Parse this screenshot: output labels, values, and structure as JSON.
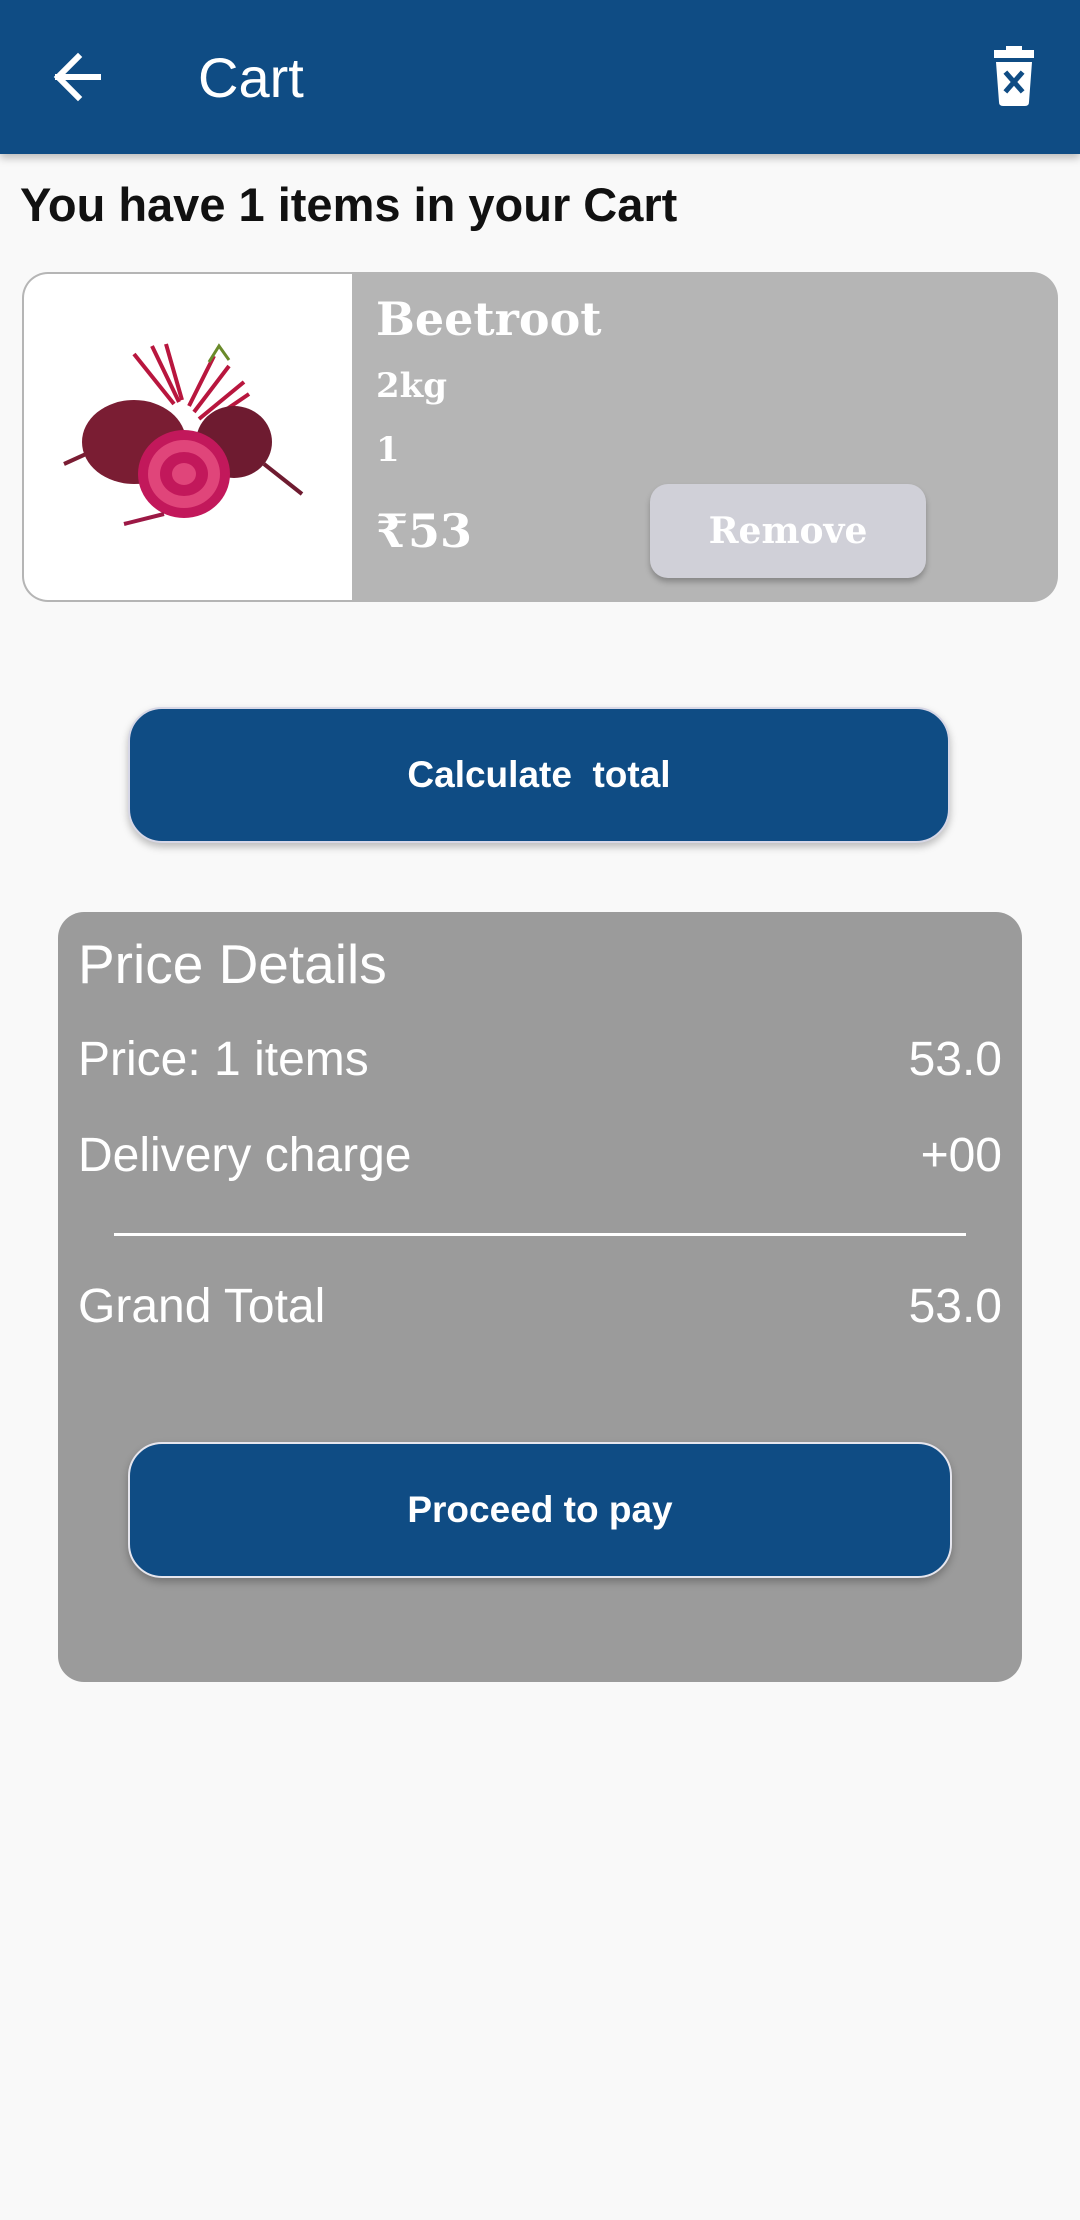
{
  "appbar": {
    "title": "Cart",
    "back_icon": "arrow-left-icon",
    "delete_icon": "trash-icon",
    "bg_color": "#0f4c84"
  },
  "cart": {
    "count_text": "You have 1 items in your Cart",
    "items": [
      {
        "name": "Beetroot",
        "weight": "2kg",
        "quantity": "1",
        "price": "₹53",
        "remove_label": "Remove"
      }
    ]
  },
  "actions": {
    "calculate_label": "Calculate  total",
    "pay_label": "Proceed to pay"
  },
  "price_details": {
    "title": "Price Details",
    "price_label": "Price: 1 items",
    "price_value": "53.0",
    "delivery_label": "Delivery charge",
    "delivery_value": "+00",
    "total_label": "Grand Total",
    "total_value": "53.0"
  }
}
